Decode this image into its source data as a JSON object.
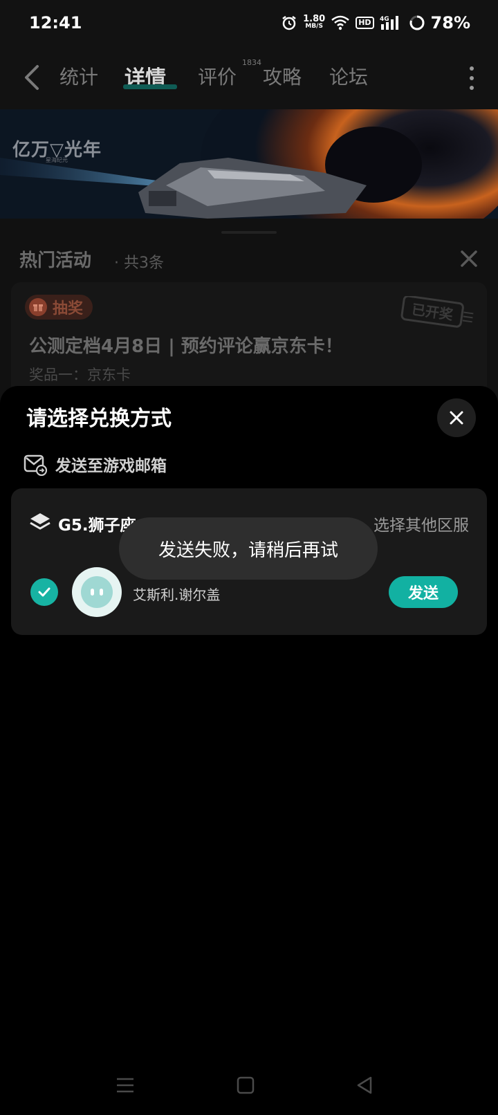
{
  "status_bar": {
    "time": "12:41",
    "net_speed_value": "1.80",
    "net_speed_unit": "MB/S",
    "hd": "HD",
    "network": "4G",
    "battery": "78%"
  },
  "nav": {
    "tabs": [
      {
        "label": "统计"
      },
      {
        "label": "详情"
      },
      {
        "label": "评价"
      },
      {
        "label": "攻略"
      },
      {
        "label": "论坛"
      }
    ],
    "active_tab": "详情",
    "review_count": "1834"
  },
  "banner": {
    "logo": "亿万▽光年",
    "logo_sub": "星海纪元"
  },
  "events": {
    "title": "热门活动",
    "count_text": "· 共3条",
    "card": {
      "tag": "抽奖",
      "stamp": "已开奖",
      "title": "公测定档4月8日 | 预约评论赢京东卡！",
      "prize": "奖品一：京东卡"
    }
  },
  "sheet": {
    "title": "请选择兑换方式",
    "send_mail_label": "发送至游戏邮箱",
    "server_name": "G5.狮子座",
    "other_server": "选择其他区服",
    "character_name": "艾斯利.谢尔盖",
    "send_label": "发送"
  },
  "toast": {
    "message": "发送失败，请稍后再试"
  },
  "colors": {
    "accent": "#12b1a2",
    "background": "#000000",
    "card": "#1a1a1a"
  }
}
